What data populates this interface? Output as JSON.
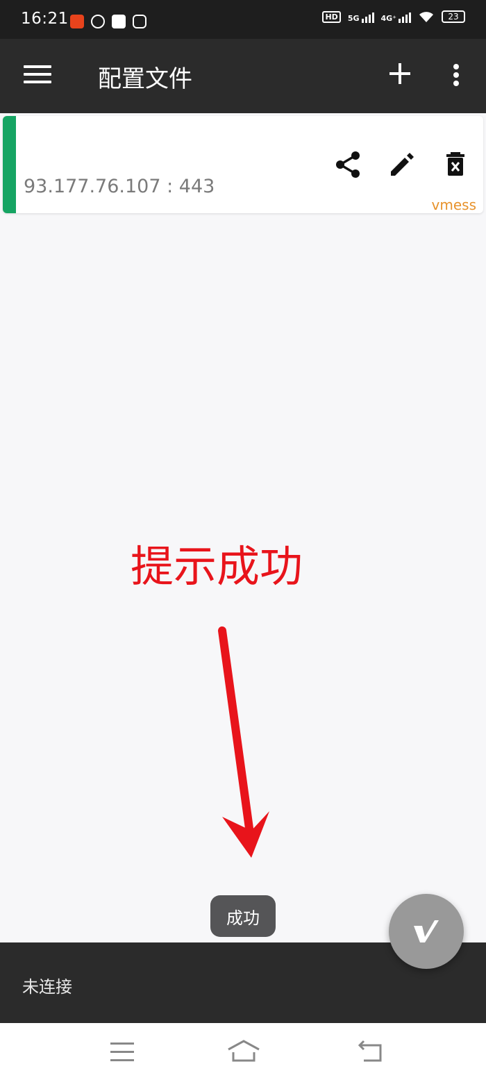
{
  "status_bar": {
    "time": "16:21",
    "hd": "HD",
    "net_5g": "5G",
    "net_4g": "4G⁺",
    "battery": "23"
  },
  "toolbar": {
    "title": "配置文件",
    "menu_icon": "hamburger-menu-icon",
    "add_icon": "plus-icon",
    "more_icon": "more-vertical-icon"
  },
  "servers": [
    {
      "address": "93.177.76.107 : 443",
      "type": "vmess",
      "selected": true,
      "indicator_color": "#16a463"
    }
  ],
  "annotation": {
    "text": "提示成功",
    "color": "#e8141b"
  },
  "toast": {
    "message": "成功"
  },
  "bottom": {
    "connection_status": "未连接"
  },
  "colors": {
    "toolbar_bg": "#2b2b2b",
    "accent_type": "#e7922b",
    "fab_bg": "#999999"
  }
}
